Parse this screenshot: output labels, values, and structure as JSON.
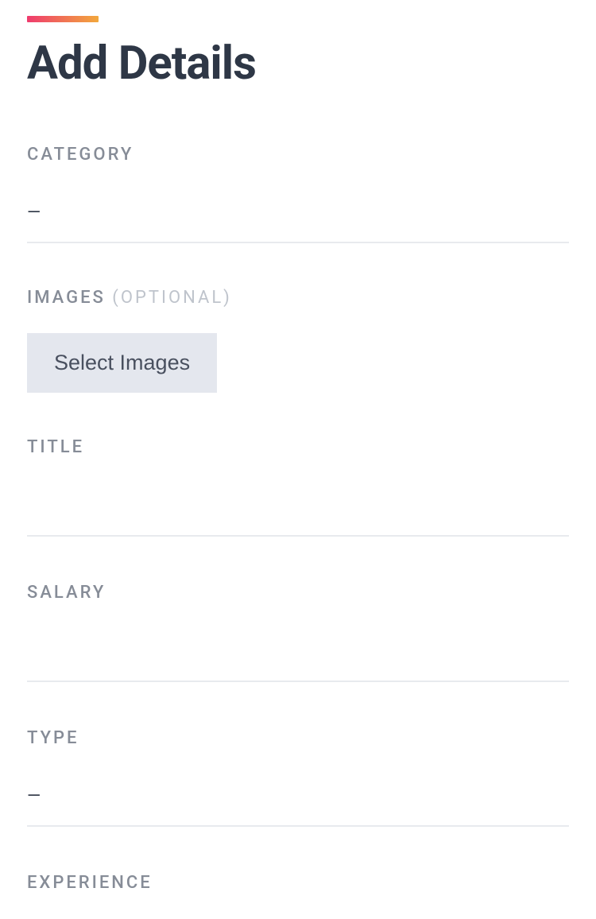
{
  "header": {
    "title": "Add Details"
  },
  "form": {
    "category": {
      "label": "CATEGORY",
      "value": "—"
    },
    "images": {
      "label": "IMAGES",
      "optional": "(OPTIONAL)",
      "button": "Select Images"
    },
    "title": {
      "label": "TITLE",
      "value": ""
    },
    "salary": {
      "label": "SALARY",
      "value": ""
    },
    "type": {
      "label": "TYPE",
      "value": "—"
    },
    "experience": {
      "label": "EXPERIENCE",
      "value": ""
    }
  }
}
